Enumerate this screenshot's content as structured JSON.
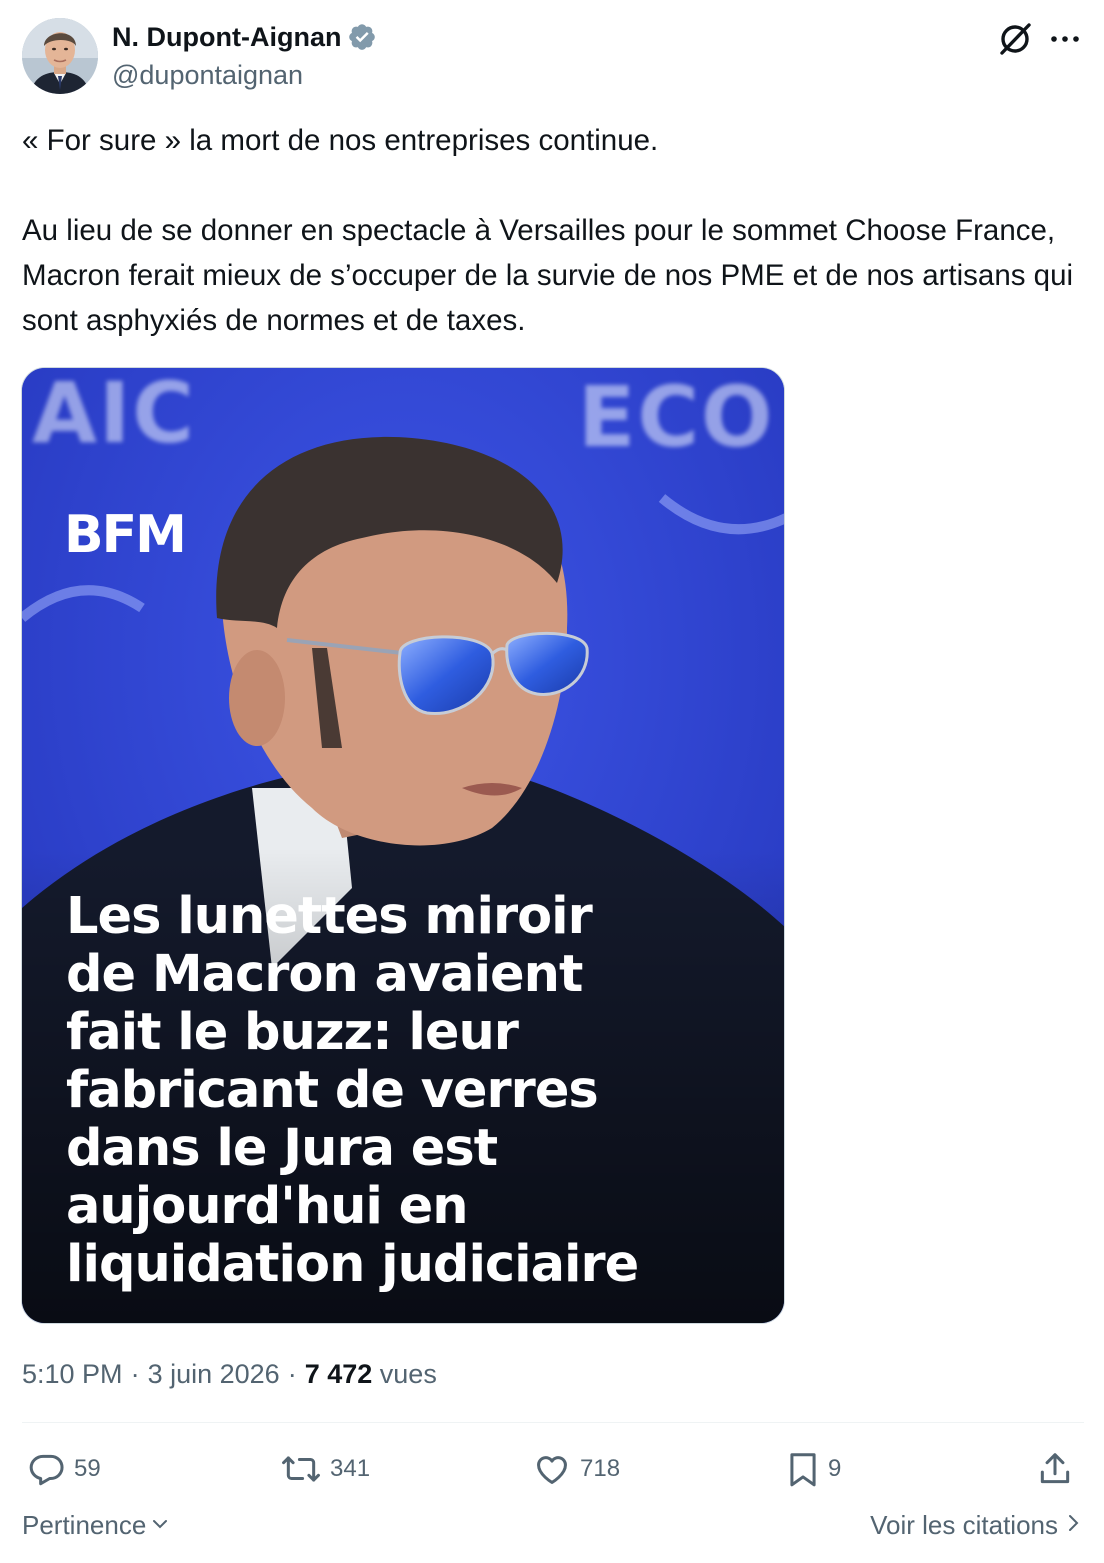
{
  "author": {
    "display_name": "N. Dupont-Aignan",
    "handle": "@dupontaignan",
    "verified_color": "#829aab"
  },
  "icons": {
    "verified": "verified-badge-icon",
    "grok": "grok-icon",
    "more": "more-options-icon",
    "reply": "reply-icon",
    "retweet": "retweet-icon",
    "like": "like-icon",
    "bookmark": "bookmark-icon",
    "share": "share-icon"
  },
  "tweet": {
    "paragraphs": [
      "« For sure » la mort de nos entreprises continue.",
      "Au lieu de se donner en spectacle à Versailles pour le sommet Choose France, Macron ferait mieux de s’occuper de la survie de nos PME et de nos artisans qui sont asphyxiés de normes et de taxes."
    ]
  },
  "media": {
    "logo": "BFM",
    "headline": "Les lunettes miroir\nde Macron avaient\nfait le buzz: leur\nfabricant de verres\ndans le Jura est\naujourd'hui en\nliquidation judiciaire",
    "background_text_left": "AIC",
    "background_text_right": "ECO",
    "background_color": "#2c3fd0"
  },
  "meta": {
    "time": "5:10 PM",
    "separator": "·",
    "date": "3 juin 2026",
    "views_count": "7 472",
    "views_label": "vues"
  },
  "actions": {
    "replies": "59",
    "retweets": "341",
    "likes": "718",
    "bookmarks": "9"
  },
  "footer": {
    "sort_label": "Pertinence",
    "quotes_label": "Voir les citations"
  },
  "colors": {
    "text": "#0f1419",
    "secondary": "#536471",
    "border": "#cfd9de"
  }
}
